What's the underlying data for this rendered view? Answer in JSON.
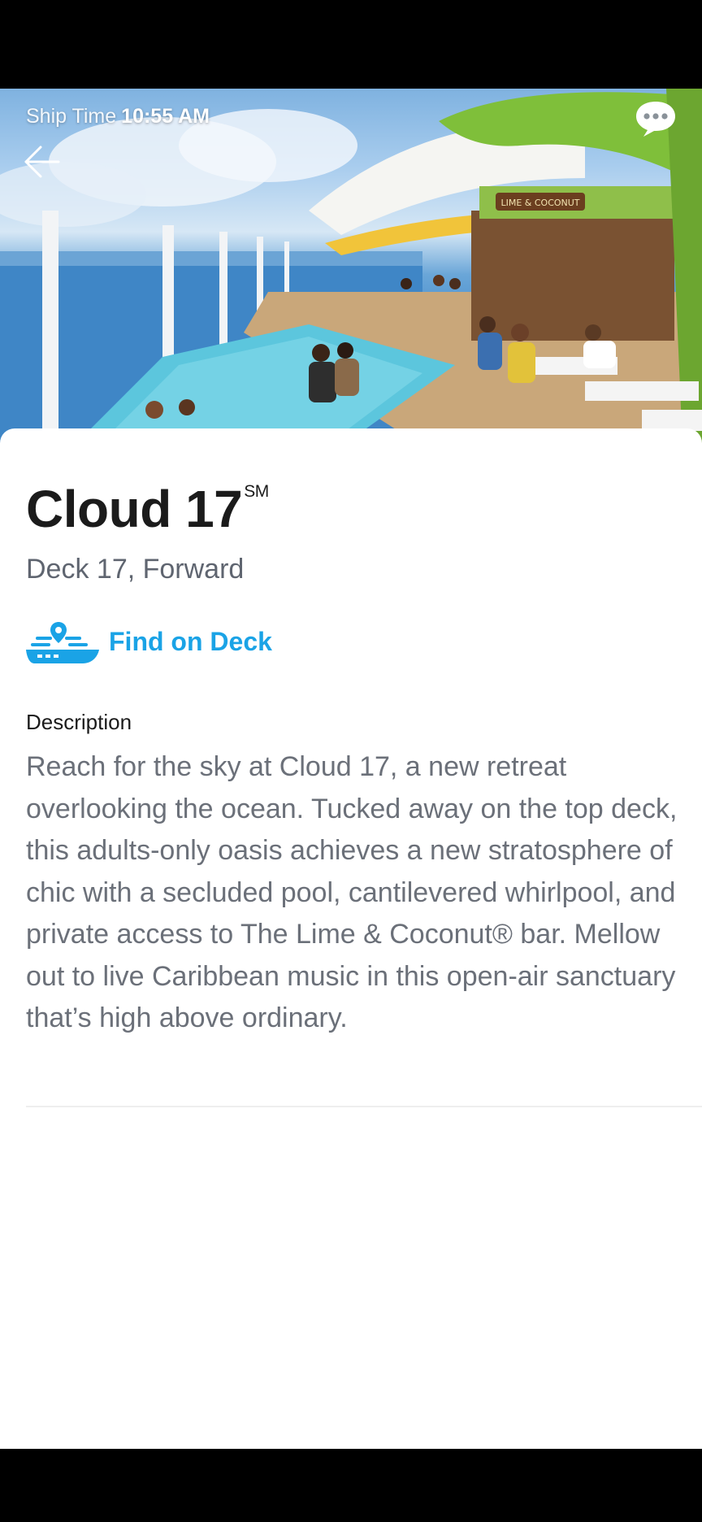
{
  "status_bar": {},
  "header": {
    "ship_time_label": "Ship Time",
    "ship_time_value": "10:55 AM",
    "back_icon": "arrow-left-icon",
    "chat_icon": "chat-bubble-icon"
  },
  "venue": {
    "name": "Cloud 17",
    "name_mark": "SM",
    "location": "Deck 17, Forward",
    "find_on_deck_label": "Find on Deck",
    "find_on_deck_icon": "ship-location-icon"
  },
  "description": {
    "heading": "Description",
    "body": "Reach for the sky at Cloud 17, a new retreat overlooking the ocean. Tucked away on the top deck, this adults-only oasis achieves a new stratosphere of chic with a secluded pool, cantilevered whirlpool, and private access to The Lime & Coconut® bar. Mellow out to live Caribbean music in this open-air sanctuary that’s high above ordinary."
  },
  "hero_signage": "LIME & COCONUT",
  "colors": {
    "accent": "#1aa3e6",
    "title": "#1b1b1b",
    "secondary_text": "#5f6570",
    "body_text": "#6b7079"
  }
}
